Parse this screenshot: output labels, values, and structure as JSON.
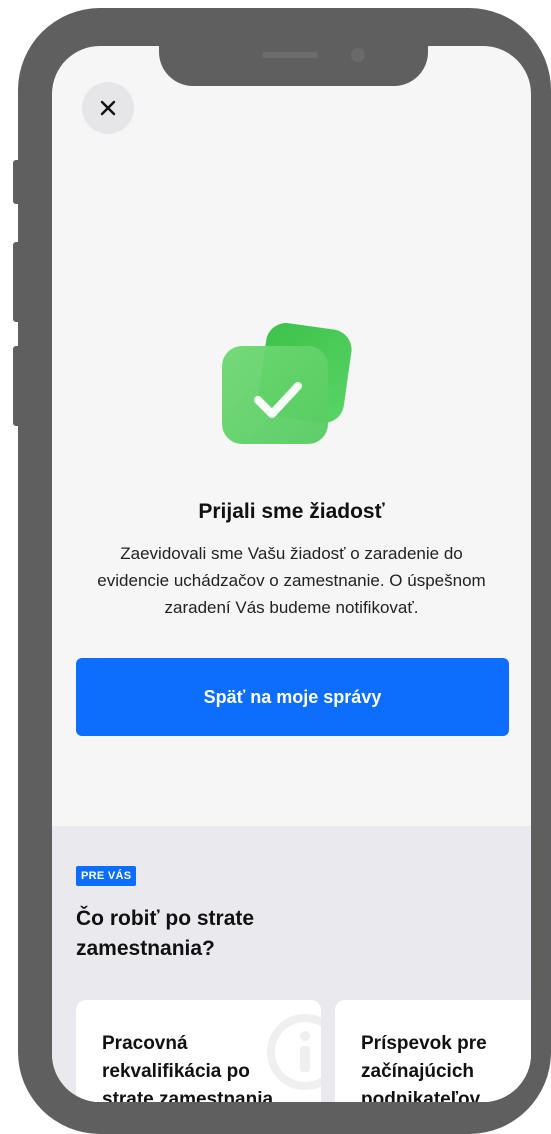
{
  "close": {
    "icon": "close-icon"
  },
  "hero": {
    "icon": "check-success-icon",
    "colors": {
      "front": "#5fd068",
      "back": "#3fbf4d",
      "check": "#ffffff"
    }
  },
  "confirmation": {
    "title": "Prijali sme žiadosť",
    "description": "Zaevidovali sme Vašu žiadosť o zaradenie do evidencie uchádzačov o zamestnanie. O úspešnom zaradení Vás budeme notifikovať."
  },
  "actions": {
    "back_label": "Späť na moje správy"
  },
  "for_you": {
    "badge": "PRE VÁS",
    "title": "Čo robiť po strate zamestnania?",
    "cards": [
      {
        "title": "Pracovná rekvalifikácia po strate zamestnania",
        "icon": "info-icon"
      },
      {
        "title": "Príspevok pre začínajúcich podnikateľov",
        "icon": ""
      }
    ]
  },
  "colors": {
    "accent": "#0d6efd",
    "frame": "#5f5f5f",
    "screen_bg": "#f6f6f7",
    "section_bg": "#e9e9ee"
  }
}
